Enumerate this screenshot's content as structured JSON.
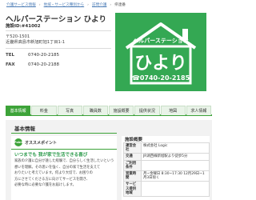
{
  "breadcrumb": {
    "items": [
      "介護サービス情報",
      "地域・サービス種別から",
      "訪問介護"
    ],
    "current": "県連番"
  },
  "facility": {
    "name": "ヘルパーステーション ひより",
    "id_text": "施設ID:#41002",
    "postal": "〒520-1501",
    "address": "近畿県高島市新旭町旭1丁目1-1",
    "tel_label": "TEL",
    "tel": "0740-20-2185",
    "fax_label": "FAX",
    "fax": "0740-20-2188"
  },
  "logo": {
    "top_text": "ヘルパーステーション",
    "main_text": "ひより",
    "phone": "☎0740-20-2185",
    "colors": {
      "green": "#34a853",
      "white": "#ffffff"
    }
  },
  "tabs": [
    {
      "label": "基本情報",
      "active": true
    },
    {
      "label": "料金",
      "active": false
    },
    {
      "label": "写真",
      "active": false
    },
    {
      "label": "職員数",
      "active": false
    },
    {
      "label": "施設概要",
      "active": false
    },
    {
      "label": "提供状況",
      "active": false
    },
    {
      "label": "地図",
      "active": false
    },
    {
      "label": "求人情報",
      "active": false
    }
  ],
  "main": {
    "section_title": "基本情報",
    "point_badge": "Point",
    "point_label": "オススメポイント",
    "catchphrase": "いつまでも 我が家で生活できる喜び",
    "description_lines": [
      "家族の介護に自分が遠した経験で、自分らしく生活したいという",
      "想いを理解。その思いを強く、自分の家で生活を支えて",
      "おりたいと考えています。何より大切で、お困りの",
      "方にさせてくださる方に向けてサービスを開き、",
      "必要な時に必要な介護をお届けします。"
    ]
  },
  "overview": {
    "title": "施設概要",
    "rows": [
      {
        "key": "運営会社",
        "value": "株式会社 Logic"
      },
      {
        "key": "交通",
        "value": "JR湖西線新旭駅より徒歩5分"
      },
      {
        "key": "ご利用条件",
        "value": ""
      },
      {
        "key": "営業時間",
        "value": "月~金曜日 8:30~17:30 12月29日~1月3日除く"
      },
      {
        "key": "サービス提供地域",
        "value": ""
      }
    ]
  }
}
